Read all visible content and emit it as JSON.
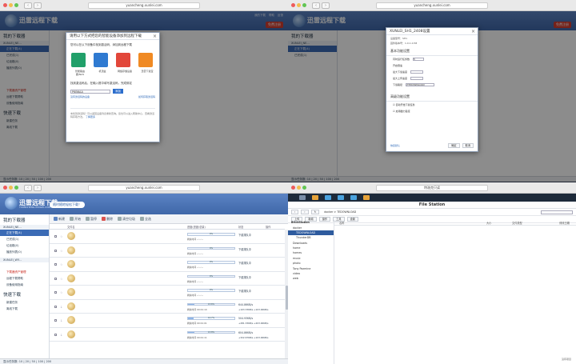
{
  "browser": {
    "url_q1": "yuancheng.xunlei.com",
    "url_q2": "yuancheng.xunlei.com",
    "url_q3": "yuancheng.xunlei.com",
    "url_q4": "特洛克只读"
  },
  "app": {
    "logo": "迅雷远程下载",
    "logo_sub": "YUANCHENG.XUNLEI.COM",
    "slogan": "随时随地轻松下载！",
    "top_links": [
      "我的下载",
      "帮助",
      "反馈",
      "退出"
    ],
    "register": "免费注册"
  },
  "sidebar": {
    "title": "我的下载器",
    "device": "XUNLEI_NE...",
    "items": [
      "正在下载(4)",
      "已完成(1)",
      "垃圾箱(0)",
      "播放列表(0)"
    ],
    "device2": "XUNLEI_WY...",
    "links": [
      "下载器资产管理",
      "远程下载帮助",
      "设备使用指南"
    ],
    "quick_title": "快速下载",
    "quick_items": [
      "新建任务",
      "离线下载"
    ]
  },
  "toolbar": {
    "labels": [
      "新建",
      "开始",
      "暂停",
      "删除",
      "清空垃圾",
      "全选"
    ]
  },
  "statusbar": {
    "text": "显示任务数: 10 | 20 | 50 | 100 | 200"
  },
  "bind_modal": {
    "title": "请用以下方式把您的智能设备添加到远程下载",
    "step": "您可以在以下设备中找到激活码，添加到远程下载",
    "tiles": [
      "智能路由器/NAS",
      "机顶盒",
      "网络存储设备",
      "迅雷下载宝"
    ],
    "input_label": "找到激活码后，在输入框中填写激活码，完成绑定",
    "input_value": "P6B6AA",
    "bind_btn": "添加",
    "help1": "如何获取激活码",
    "help2": "没有激活码的设备",
    "note": "未找到激活码？可以返回设备列表重新查询。您也可以进入帮助中心，查看激活码获取方法。",
    "link_more": "了解更多"
  },
  "settings_modal": {
    "title": "XUNLEI_SH1_2408设置",
    "device_model": "设备型号：SH1",
    "version": "固件版本号：1.0.1.0.58",
    "section1": "基本功能设置",
    "rows": [
      "同时运行任务数",
      "开启限速",
      "最大下载速度",
      "最大上传速度",
      "下载路径"
    ],
    "task_count": "5",
    "path": "/TEDOWNLOAD",
    "section2": "高级功能设置",
    "checks": [
      "自动开始下载任务",
      "启用磁力链接"
    ],
    "restore": "恢复默认",
    "ok": "确定",
    "cancel": "取消"
  },
  "downloads": {
    "header": [
      "文件名",
      "进度(进度/总量)",
      "状态",
      "操作"
    ],
    "rows": [
      {
        "progress": "0%",
        "progress_fraction": 0.0,
        "sub": "剩余时间  --:--:--",
        "state": "下载排队中",
        "speed": ""
      },
      {
        "progress": "0%",
        "progress_fraction": 0.0,
        "sub": "剩余时间  --:--:--",
        "state": "下载排队中",
        "speed": ""
      },
      {
        "progress": "0%",
        "progress_fraction": 0.0,
        "sub": "剩余时间  --:--:--",
        "state": "下载排队中",
        "speed": ""
      },
      {
        "progress": "0%",
        "progress_fraction": 0.0,
        "sub": "剩余时间  --:--:--",
        "state": "下载排队中",
        "speed": ""
      },
      {
        "progress": "0%",
        "progress_fraction": 0.0,
        "sub": "剩余时间  --:--:--",
        "state": "下载排队中",
        "speed": ""
      },
      {
        "progress": "13.6%",
        "progress_fraction": 0.136,
        "sub": "剩余时间  00:01:10",
        "state": "644.86KB/s",
        "speed": "+103.33KB/s  +103.00KB/s"
      },
      {
        "progress": "12.7%",
        "progress_fraction": 0.127,
        "sub": "剩余时间  00:01:01",
        "state": "504.93KB/s",
        "speed": "+281.33KB/s  +203.00KB/s"
      },
      {
        "progress": "13.8%",
        "progress_fraction": 0.138,
        "sub": "剩余时间  00:01:11",
        "state": "604.86KB/s",
        "speed": "+322.67KB/s  +103.00KB/s"
      }
    ]
  },
  "filestation": {
    "title": "File Station",
    "path": "docker  >  TEDOWNLOAD",
    "buttons": [
      "上传",
      "新增",
      "操作",
      "工具",
      "设置"
    ],
    "columns": [
      "名称",
      "大小",
      "文件类型",
      "修改日期"
    ],
    "root": "BrickStation",
    "tree": [
      "docker",
      "TEDOWNLOAD",
      "ThunderDB",
      "Downloads",
      "home",
      "homes",
      "music",
      "photo",
      "Tony Pazmine",
      "video",
      "web"
    ],
    "empty_note": "没有项目"
  },
  "colors": {
    "accent": "#3b6bb5",
    "danger": "#d63c2e"
  }
}
